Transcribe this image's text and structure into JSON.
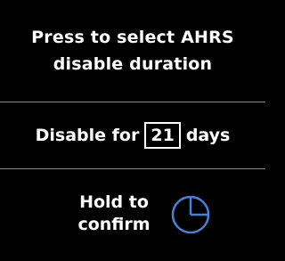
{
  "header": {
    "line1": "Press to select AHRS",
    "line2": "disable duration"
  },
  "duration": {
    "prefix": "Disable for",
    "days": "21",
    "suffix": "days"
  },
  "confirm": {
    "line1": "Hold to",
    "line2": "confirm",
    "icon": "timer-icon",
    "icon_color": "#4a7fd6"
  },
  "colors": {
    "background": "#000000",
    "text": "#ffffff",
    "divider": "#8a8a8a",
    "accent": "#4a7fd6"
  }
}
